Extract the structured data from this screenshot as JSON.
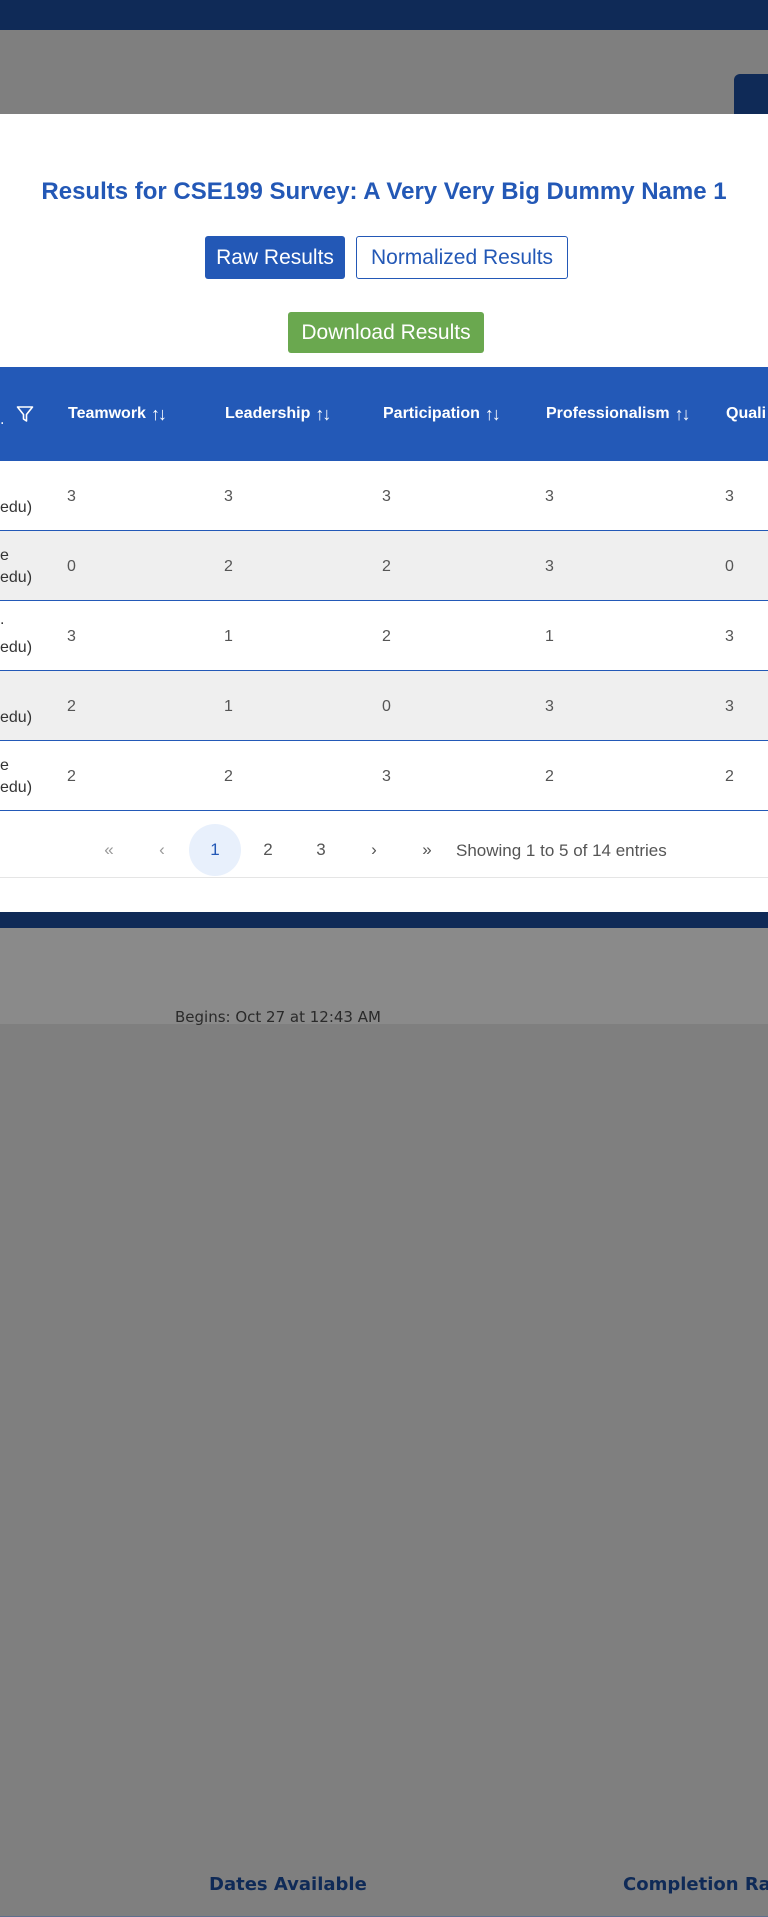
{
  "modal": {
    "title": "Results for CSE199 Survey: A Very Very Big Dummy Name 1",
    "raw_button": "Raw Results",
    "normalized_button": "Normalized Results",
    "download_button": "Download Results"
  },
  "table": {
    "columns": [
      "Teamwork",
      "Leadership",
      "Participation",
      "Professionalism",
      "Quali"
    ],
    "rows": [
      {
        "name_line1": "",
        "name_line2": "edu)",
        "values": [
          "3",
          "3",
          "3",
          "3",
          "3"
        ]
      },
      {
        "name_line1": "e",
        "name_line2": "edu)",
        "values": [
          "0",
          "2",
          "2",
          "3",
          "0"
        ]
      },
      {
        "name_line1": ".",
        "name_line2": "edu)",
        "values": [
          "3",
          "1",
          "2",
          "1",
          "3"
        ]
      },
      {
        "name_line1": "",
        "name_line2": "edu)",
        "values": [
          "2",
          "1",
          "0",
          "3",
          "3"
        ]
      },
      {
        "name_line1": "e",
        "name_line2": "edu)",
        "values": [
          "2",
          "2",
          "3",
          "2",
          "2"
        ]
      }
    ]
  },
  "pagination": {
    "first": "«",
    "prev": "‹",
    "pages": [
      "1",
      "2",
      "3"
    ],
    "active_page": "1",
    "next": "›",
    "last": "»",
    "entries_text": "Showing 1 to 5 of 14 entries"
  },
  "background_table": {
    "col_dates": "Dates Available",
    "col_completion": "Completion Rat",
    "row_begins": "Begins: Oct 27 at 12:43 AM"
  },
  "colors": {
    "primary": "#2358b6",
    "navy": "#0f2a57",
    "success": "#6aa84f"
  }
}
